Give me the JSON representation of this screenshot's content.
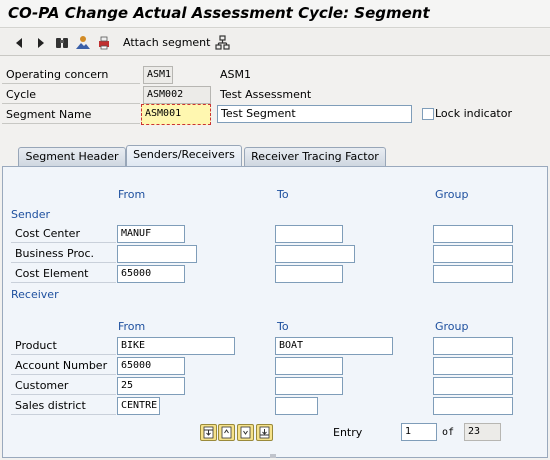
{
  "window": {
    "title": "CO-PA Change Actual Assessment Cycle: Segment"
  },
  "toolbar": {
    "attach_segment_label": "Attach segment"
  },
  "header": {
    "operating_concern_label": "Operating concern",
    "operating_concern_value": "ASM1",
    "operating_concern_text": "ASM1",
    "cycle_label": "Cycle",
    "cycle_value": "ASM002",
    "cycle_text": "Test Assessment",
    "segment_name_label": "Segment Name",
    "segment_name_value": "ASM001",
    "segment_name_text": "Test Segment",
    "lock_indicator_label": "Lock indicator"
  },
  "tabs": [
    {
      "label": "Segment Header"
    },
    {
      "label": "Senders/Receivers"
    },
    {
      "label": "Receiver Tracing Factor"
    }
  ],
  "columns": {
    "from": "From",
    "to": "To",
    "group": "Group"
  },
  "sender": {
    "title": "Sender",
    "rows": [
      {
        "label": "Cost Center",
        "from": "MANUF",
        "to": "",
        "group": ""
      },
      {
        "label": "Business Proc.",
        "from": "",
        "to": "",
        "group": ""
      },
      {
        "label": "Cost Element",
        "from": "65000",
        "to": "",
        "group": ""
      }
    ]
  },
  "receiver": {
    "title": "Receiver",
    "rows": [
      {
        "label": "Product",
        "from": "BIKE",
        "to": "BOAT",
        "group": ""
      },
      {
        "label": "Account Number",
        "from": "65000",
        "to": "",
        "group": ""
      },
      {
        "label": "Customer",
        "from": "25",
        "to": "",
        "group": ""
      },
      {
        "label": "Sales district",
        "from": "CENTRE",
        "to": "",
        "group": ""
      }
    ]
  },
  "pager": {
    "entry_label": "Entry",
    "entry_value": "1",
    "of_label": "of",
    "total": "23"
  }
}
